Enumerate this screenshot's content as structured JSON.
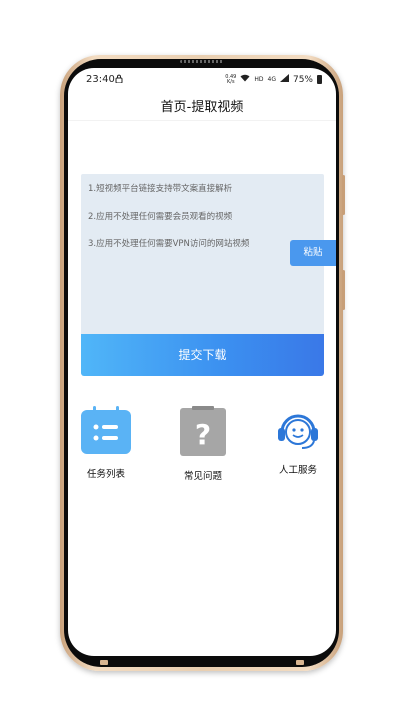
{
  "status_bar": {
    "time": "23:40",
    "speed_value": "0.49",
    "speed_unit": "K/s",
    "hd_label": "HD",
    "network_label": "4G",
    "battery": "75%"
  },
  "header": {
    "title": "首页-提取视频"
  },
  "input": {
    "hints": [
      "1.短视频平台链接支持带文案直接解析",
      "2.应用不处理任何需要会员观看的视频",
      "3.应用不处理任何需要VPN访问的网站视频"
    ],
    "paste_label": "粘贴"
  },
  "submit": {
    "label": "提交下载"
  },
  "features": [
    {
      "label": "任务列表",
      "icon": "task-list-icon"
    },
    {
      "label": "常见问题",
      "icon": "faq-icon"
    },
    {
      "label": "人工服务",
      "icon": "customer-service-icon"
    }
  ],
  "colors": {
    "accent": "#4a98ee",
    "input_bg": "#e3ebf3",
    "frame_gold": "#e9cfb1"
  }
}
